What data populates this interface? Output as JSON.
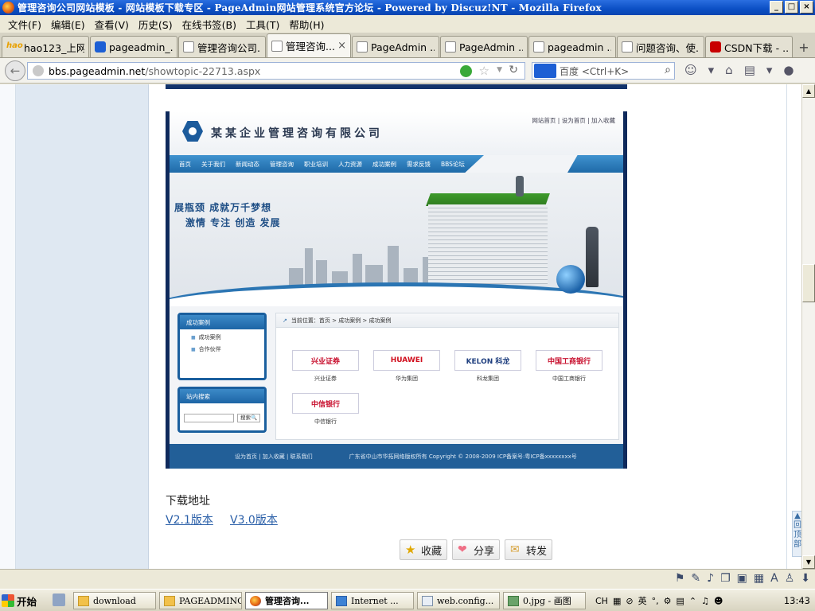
{
  "window": {
    "title": "管理咨询公司网站模板 - 网站模板下载专区 - PageAdmin网站管理系统官方论坛 - Powered by Discuz!NT - Mozilla Firefox",
    "min": "_",
    "max": "□",
    "close": "×"
  },
  "menu": [
    "文件(F)",
    "编辑(E)",
    "查看(V)",
    "历史(S)",
    "在线书签(B)",
    "工具(T)",
    "帮助(H)"
  ],
  "tabs": [
    {
      "label": "hao123_上网...",
      "icon": "hao123-icon"
    },
    {
      "label": "pageadmin_...",
      "icon": "baidu-paw-icon"
    },
    {
      "label": "管理咨询公司...",
      "icon": "page-icon"
    },
    {
      "label": "管理咨询...",
      "icon": "page-icon",
      "active": true,
      "close": "×"
    },
    {
      "label": "PageAdmin ...",
      "icon": "page-icon"
    },
    {
      "label": "PageAdmin ...",
      "icon": "page-icon"
    },
    {
      "label": "pageadmin ...",
      "icon": "page-icon"
    },
    {
      "label": "问题咨询、使...",
      "icon": "page-icon"
    },
    {
      "label": "CSDN下载 - ...",
      "icon": "csdn-icon"
    }
  ],
  "newtab": "+",
  "nav": {
    "url_host": "bbs.pageadmin.net",
    "url_path": "/showtopic-22713.aspx",
    "search_placeholder": "百度 <Ctrl+K>"
  },
  "template": {
    "company": "某某企业管理咨询有限公司",
    "toplinks": "网站首页 | 设为首页 | 加入收藏",
    "nav": [
      "首页",
      "关于我们",
      "新闻动态",
      "管理咨询",
      "职业培训",
      "人力资源",
      "成功案例",
      "需求反馈",
      "BBS论坛"
    ],
    "slogan1": "展瓶颈 成就万千梦想",
    "slogan2": "激情 专注 创造 发展",
    "side_title": "成功案例",
    "side_items": [
      "成功案例",
      "合作伙伴"
    ],
    "search_title": "站内搜索",
    "search_btn": "搜索🔍",
    "crumb": "当前位置：首页 > 成功案例 > 成功案例",
    "logos": [
      {
        "mark": "兴业证券",
        "name": "兴业证券",
        "color": "#c8102e"
      },
      {
        "mark": "HUAWEI",
        "name": "华为集团",
        "color": "#d10f1e"
      },
      {
        "mark": "KELON 科龙",
        "name": "科龙集团",
        "color": "#1f3f7f"
      },
      {
        "mark": "中国工商银行",
        "name": "中国工商银行",
        "color": "#c8102e"
      },
      {
        "mark": "中信银行",
        "name": "中信银行",
        "color": "#c8102e"
      }
    ],
    "footer_left": "设为首页 | 加入收藏 | 联系我们",
    "footer_right": "广东省中山市华拓网络版权所有 Copyright © 2008-2009  ICP备案号:粤ICP备xxxxxxxx号"
  },
  "downloads": {
    "title": "下载地址",
    "links": [
      "V2.1版本",
      "V3.0版本"
    ]
  },
  "actions": [
    "收藏",
    "分享",
    "转发"
  ],
  "totop": "回顶部",
  "taskbar": {
    "start": "开始",
    "tasks": [
      {
        "label": "download",
        "icon": "folder"
      },
      {
        "label": "PAGEADMINGLZX",
        "icon": "folder"
      },
      {
        "label": "管理咨询...",
        "icon": "firefox",
        "active": true
      },
      {
        "label": "Internet ...",
        "icon": "ie"
      },
      {
        "label": "web.config...",
        "icon": "notepad"
      },
      {
        "label": "0.jpg - 画图",
        "icon": "paint"
      }
    ],
    "ime": "CH",
    "lang": "英",
    "clock": "13:43"
  }
}
